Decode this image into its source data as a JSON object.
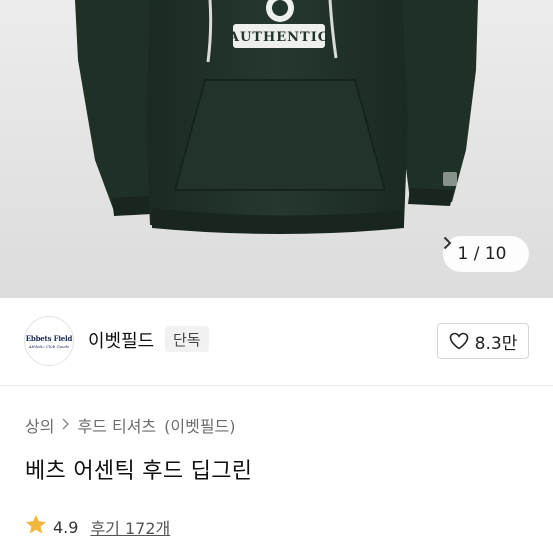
{
  "product_image": {
    "printed_text": "AUTHENTIC",
    "counter": {
      "current": "1",
      "separator": "/",
      "total": "10"
    },
    "next_icon": "chevron-right-icon"
  },
  "brand": {
    "logo_text_line1": "Ebbets Field",
    "logo_text_line2": "Athletic Club Goods",
    "name": "이벳필드",
    "badge": "단독",
    "like_icon": "heart-icon",
    "like_count": "8.3만"
  },
  "breadcrumb": {
    "items": [
      "상의",
      "후드 티셔츠",
      "(이벳필드)"
    ],
    "separator_icon": "chevron-right-icon"
  },
  "product": {
    "title": "베츠 어센틱 후드 딥그린"
  },
  "rating": {
    "star_icon": "star-icon",
    "score": "4.9",
    "reviews_label": "후기 172개"
  },
  "colors": {
    "hoodie": "#23342b",
    "background": "#e4e4e4",
    "star": "#f0b73a"
  }
}
